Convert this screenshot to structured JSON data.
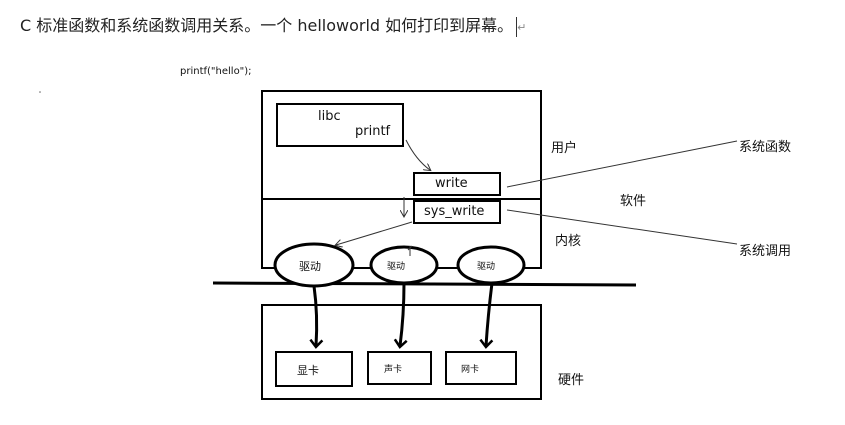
{
  "heading": {
    "text": "C 标准函数和系统函数调用关系。一个 helloworld 如何打印到屏幕。",
    "return_mark": "↵"
  },
  "code_label": "printf(\"hello\");",
  "libc_box": {
    "title": "libc",
    "func": "printf"
  },
  "user_box": {
    "write": "write"
  },
  "kernel_box": {
    "sys_write": "sys_write"
  },
  "drivers": [
    "驱动",
    "驱动",
    "驱动"
  ],
  "hardware": [
    "显卡",
    "声卡",
    "网卡"
  ],
  "region_labels": {
    "user": "用户",
    "software": "软件",
    "kernel": "内核",
    "hardware": "硬件",
    "syscall_func": "系统函数",
    "syscall": "系统调用"
  }
}
